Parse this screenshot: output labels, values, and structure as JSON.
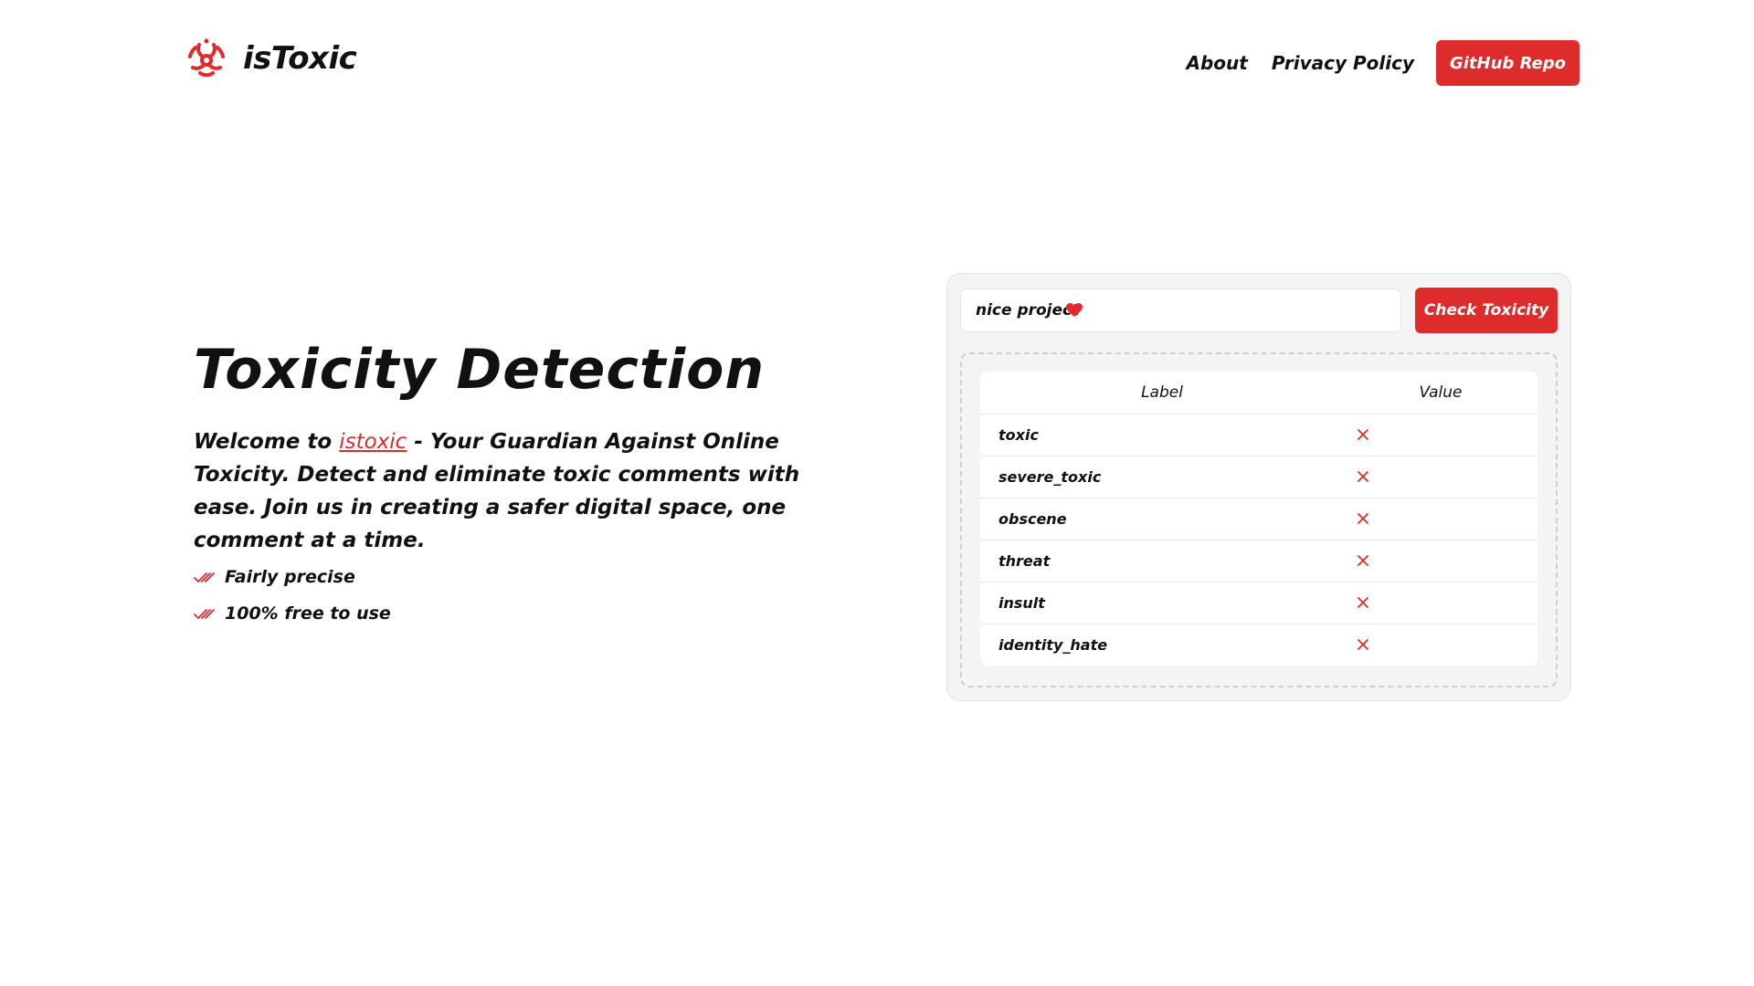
{
  "header": {
    "brand_name": "isToxic",
    "nav": [
      {
        "label": "About"
      },
      {
        "label": "Privacy Policy"
      }
    ],
    "github_button": "GitHub Repo"
  },
  "hero": {
    "title": "Toxicity Detection",
    "description_prefix": "Welcome to ",
    "description_brand": "istoxic",
    "description_suffix": " - Your Guardian Against Online Toxicity. Detect and eliminate toxic comments with ease. Join us in creating a safer digital space, one comment at a time.",
    "features": [
      {
        "label": "Fairly precise",
        "icon": "double-check-icon"
      },
      {
        "label": "100% free to use",
        "icon": "double-check-icon"
      }
    ]
  },
  "checker": {
    "input_value": "nice project",
    "input_emoji": "heart-icon",
    "button_label": "Check Toxicity",
    "table": {
      "headers": [
        "Label",
        "Value"
      ],
      "rows": [
        {
          "label": "toxic",
          "value": "x-icon"
        },
        {
          "label": "severe_toxic",
          "value": "x-icon"
        },
        {
          "label": "obscene",
          "value": "x-icon"
        },
        {
          "label": "threat",
          "value": "x-icon"
        },
        {
          "label": "insult",
          "value": "x-icon"
        },
        {
          "label": "identity_hate",
          "value": "x-icon"
        }
      ]
    }
  },
  "colors": {
    "accent": "#de2b2b",
    "card_bg": "#f4f4f4",
    "text": "#111111"
  }
}
